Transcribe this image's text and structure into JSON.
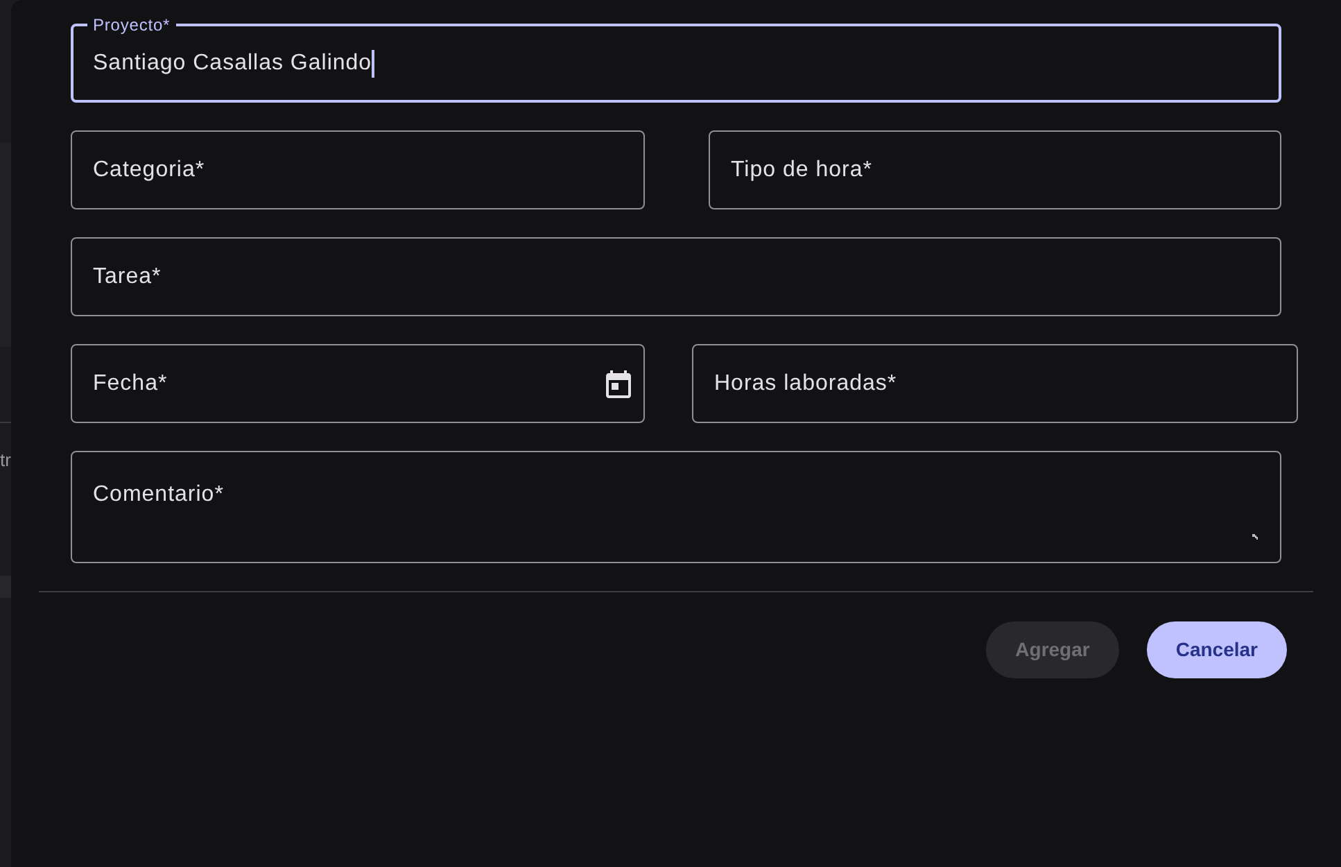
{
  "backdrop": {
    "text": "tr"
  },
  "form": {
    "rows": [
      {
        "fields": [
          {
            "kind": "text",
            "label": "Proyecto*",
            "value": "Santiago Casallas Galindo",
            "focused": true
          }
        ]
      },
      {
        "fields": [
          {
            "kind": "text",
            "label": "Categoria*",
            "focused": false
          },
          {
            "kind": "text",
            "label": "Tipo de hora*",
            "focused": false
          }
        ]
      },
      {
        "fields": [
          {
            "kind": "text",
            "label": "Tarea*",
            "focused": false
          }
        ]
      },
      {
        "fields": [
          {
            "kind": "date",
            "label": "Fecha*",
            "focused": false
          },
          {
            "kind": "text",
            "label": "Horas laboradas*",
            "focused": false
          }
        ]
      },
      {
        "fields": [
          {
            "kind": "textarea",
            "label": "Comentario*",
            "focused": false
          }
        ]
      }
    ]
  },
  "buttons": [
    {
      "label": "Agregar",
      "disabled": true
    },
    {
      "label": "Cancelar",
      "disabled": false
    }
  ]
}
